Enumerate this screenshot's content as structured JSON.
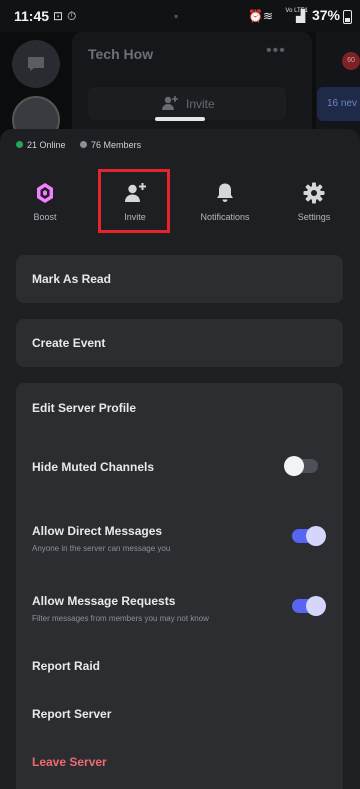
{
  "status_bar": {
    "time": "11:45",
    "network_label": "Vo LTE1",
    "signal_label": "LTE1",
    "battery": "37%"
  },
  "background": {
    "server_name": "Tech How",
    "invite_label": "Invite",
    "new_pill": "16 nev",
    "badge": "60"
  },
  "sheet": {
    "online_count": "21 Online",
    "member_count": "76 Members",
    "actions": [
      {
        "label": "Boost",
        "icon": "boost-icon"
      },
      {
        "label": "Invite",
        "icon": "add-user-icon"
      },
      {
        "label": "Notifications",
        "icon": "bell-icon"
      },
      {
        "label": "Settings",
        "icon": "gear-icon"
      }
    ],
    "mark_as_read": "Mark As Read",
    "create_event": "Create Event",
    "items": {
      "edit_profile": "Edit Server Profile",
      "hide_muted": "Hide Muted Channels",
      "allow_dms": "Allow Direct Messages",
      "allow_dms_sub": "Anyone in the server can message you",
      "allow_requests": "Allow Message Requests",
      "allow_requests_sub": "Filter messages from members you may not know",
      "report_raid": "Report Raid",
      "report_server": "Report Server",
      "leave_server": "Leave Server"
    },
    "toggles": {
      "hide_muted": false,
      "allow_dms": true,
      "allow_requests": true
    }
  },
  "colors": {
    "accent": "#5865f2",
    "danger": "#f06b6f",
    "online": "#23a55a",
    "highlight": "#e5242d"
  }
}
